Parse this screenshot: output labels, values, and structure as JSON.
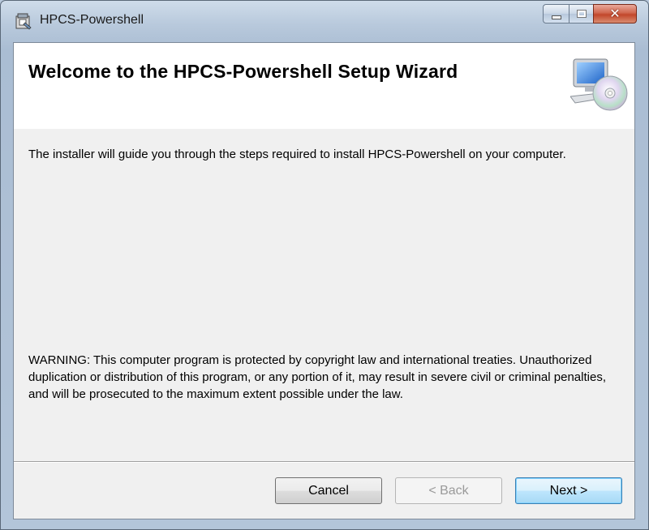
{
  "window": {
    "title": "HPCS-Powershell",
    "close_glyph": "✕"
  },
  "banner": {
    "heading": "Welcome to the HPCS-Powershell Setup Wizard",
    "icon": "computer-cd-icon"
  },
  "body": {
    "intro": "The installer will guide you through the steps required to install HPCS-Powershell on your computer.",
    "warning": "WARNING: This computer program is protected by copyright law and international treaties. Unauthorized duplication or distribution of this program, or any portion of it, may result in severe civil or criminal penalties, and will be prosecuted to the maximum extent possible under the law."
  },
  "buttons": {
    "cancel": "Cancel",
    "back": "< Back",
    "next": "Next >"
  },
  "colors": {
    "accent": "#3c7fb1",
    "close": "#c2462b"
  }
}
